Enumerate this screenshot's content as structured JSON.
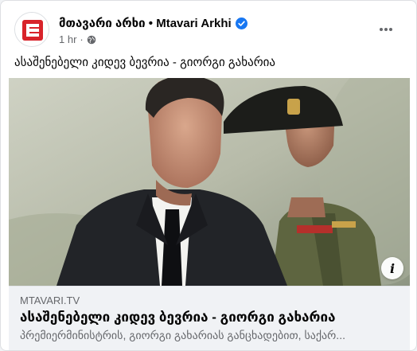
{
  "post": {
    "page_name": "მთავარი არხი • Mtavari Arkhi",
    "timestamp": "1 hr",
    "separator": "·",
    "text": "ასაშენებელი კიდევ ბევრია - გიორგი გახარია"
  },
  "link_preview": {
    "domain": "MTAVARI.TV",
    "title": "ასაშენებელი კიდევ ბევრია - გიორგი გახარია",
    "description": "პრემიერმინისტრის, გიორგი გახარიას განცხადებით, საქარ..."
  },
  "icons": {
    "avatar": "mtavari-logo",
    "verified": "verified-badge-icon",
    "privacy": "globe-icon",
    "more": "more-horizontal-icon",
    "info": "info-icon"
  },
  "colors": {
    "verified_blue": "#1877f2",
    "logo_red": "#d8232a",
    "text_primary": "#050505",
    "text_secondary": "#65676b",
    "preview_bg": "#f0f2f5"
  }
}
